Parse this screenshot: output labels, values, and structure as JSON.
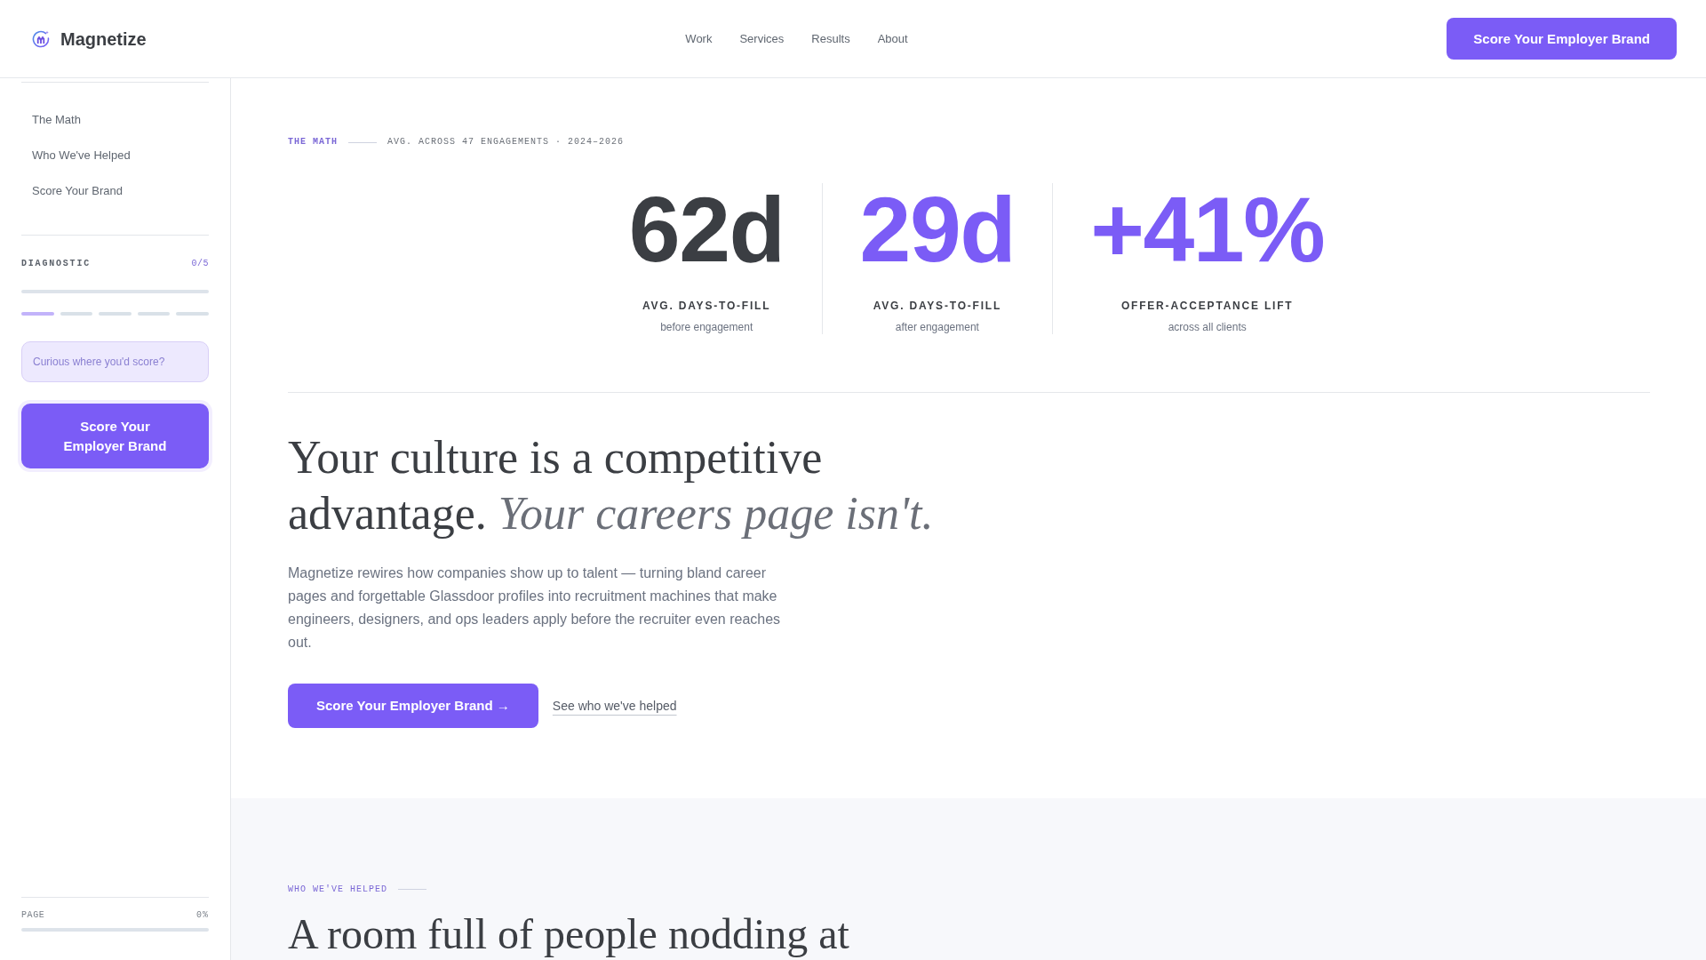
{
  "header": {
    "brand": "Magnetize",
    "nav": [
      "Work",
      "Services",
      "Results",
      "About"
    ],
    "cta": "Score Your Employer Brand"
  },
  "sidebar": {
    "items": [
      {
        "label": "The Math",
        "selected": false
      },
      {
        "label": "Who We've Helped",
        "selected": false
      },
      {
        "label": "Score Your Brand",
        "selected": false
      }
    ],
    "diagnostic": {
      "label": "DIAGNOSTIC",
      "count": "0/5",
      "level": 0,
      "steps": [
        {
          "current": true
        },
        {
          "current": false
        },
        {
          "current": false
        },
        {
          "current": false
        },
        {
          "current": false
        }
      ]
    },
    "score_input": {
      "placeholder": "Curious where you'd score?"
    },
    "cta": "Score Your Employer Brand",
    "page_progress": {
      "label": "PAGE",
      "reading": "0%",
      "level": 0
    }
  },
  "math_section": {
    "eyebrow": "THE MATH",
    "caption": "AVG. ACROSS 47 ENGAGEMENTS · 2024–2026",
    "stats": [
      {
        "value": "62d",
        "label": "AVG. DAYS-TO-FILL",
        "note": "before engagement",
        "accent": false
      },
      {
        "value": "29d",
        "label": "AVG. DAYS-TO-FILL",
        "note": "after engagement",
        "accent": true
      },
      {
        "value": "+41%",
        "label": "OFFER-ACCEPTANCE LIFT",
        "note": "across all clients",
        "accent": true
      }
    ],
    "headline": "Your culture is a competitive advantage. *Your careers page isn't.*",
    "body": "Magnetize rewires how companies show up to talent — turning bland career pages and forgettable Glassdoor profiles into recruitment machines that make engineers, designers, and ops leaders apply before the recruiter even reaches out.",
    "primary_button": "Score Your Employer Brand →",
    "secondary_link": "See who we've helped"
  },
  "helped_section": {
    "eyebrow": "WHO WE'VE HELPED",
    "headline": "A room full of people nodding at"
  }
}
